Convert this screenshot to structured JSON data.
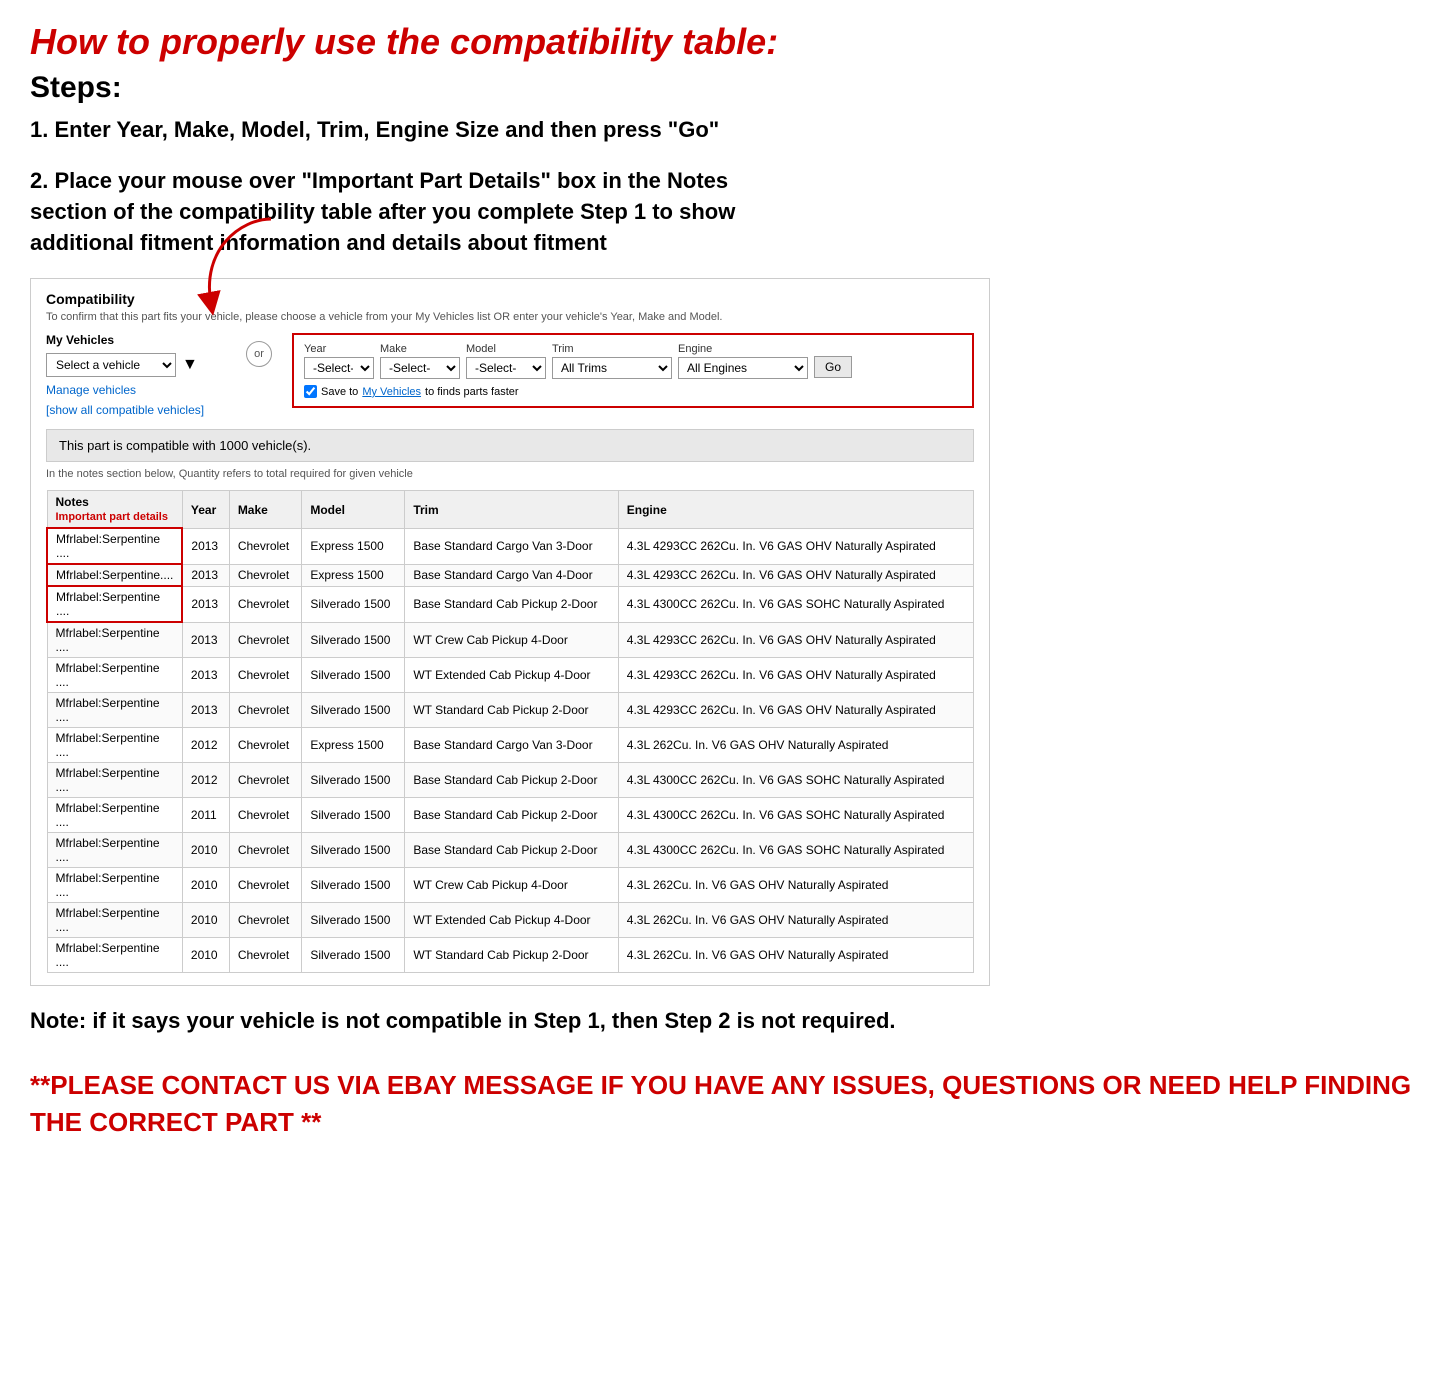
{
  "page": {
    "main_title": "How to properly use the compatibility table:",
    "steps_label": "Steps:",
    "step1": "1. Enter Year, Make, Model, Trim, Engine Size and then press \"Go\"",
    "step2_line1": "2. Place your mouse over \"Important Part Details\" box in the Notes",
    "step2_line2": "section of the compatibility table after you complete Step 1 to show",
    "step2_line3": "additional fitment information and details about fitment",
    "compat_section": {
      "title": "Compatibility",
      "subtitle": "To confirm that this part fits your vehicle, please choose a vehicle from your My Vehicles list OR enter your vehicle's Year, Make and Model.",
      "my_vehicles_label": "My Vehicles",
      "select_vehicle_placeholder": "Select a vehicle",
      "manage_vehicles": "Manage vehicles",
      "show_all": "[show all compatible vehicles]",
      "or_label": "or",
      "year_label": "Year",
      "year_value": "-Select-",
      "make_label": "Make",
      "make_value": "-Select-",
      "model_label": "Model",
      "model_value": "-Select-",
      "trim_label": "Trim",
      "trim_value": "All Trims",
      "engine_label": "Engine",
      "engine_value": "All Engines",
      "go_label": "Go",
      "save_checkbox_label": "Save to",
      "save_link": "My Vehicles",
      "save_suffix": "to finds parts faster",
      "compatible_count": "This part is compatible with 1000 vehicle(s).",
      "quantity_note": "In the notes section below, Quantity refers to total required for given vehicle",
      "table": {
        "headers": [
          "Notes",
          "Year",
          "Make",
          "Model",
          "Trim",
          "Engine"
        ],
        "notes_sub": "Important part details",
        "rows": [
          {
            "notes": "Mfrlabel:Serpentine ....",
            "year": "2013",
            "make": "Chevrolet",
            "model": "Express 1500",
            "trim": "Base Standard Cargo Van 3-Door",
            "engine": "4.3L 4293CC 262Cu. In. V6 GAS OHV Naturally Aspirated"
          },
          {
            "notes": "Mfrlabel:Serpentine....",
            "year": "2013",
            "make": "Chevrolet",
            "model": "Express 1500",
            "trim": "Base Standard Cargo Van 4-Door",
            "engine": "4.3L 4293CC 262Cu. In. V6 GAS OHV Naturally Aspirated"
          },
          {
            "notes": "Mfrlabel:Serpentine ....",
            "year": "2013",
            "make": "Chevrolet",
            "model": "Silverado 1500",
            "trim": "Base Standard Cab Pickup 2-Door",
            "engine": "4.3L 4300CC 262Cu. In. V6 GAS SOHC Naturally Aspirated"
          },
          {
            "notes": "Mfrlabel:Serpentine ....",
            "year": "2013",
            "make": "Chevrolet",
            "model": "Silverado 1500",
            "trim": "WT Crew Cab Pickup 4-Door",
            "engine": "4.3L 4293CC 262Cu. In. V6 GAS OHV Naturally Aspirated"
          },
          {
            "notes": "Mfrlabel:Serpentine ....",
            "year": "2013",
            "make": "Chevrolet",
            "model": "Silverado 1500",
            "trim": "WT Extended Cab Pickup 4-Door",
            "engine": "4.3L 4293CC 262Cu. In. V6 GAS OHV Naturally Aspirated"
          },
          {
            "notes": "Mfrlabel:Serpentine ....",
            "year": "2013",
            "make": "Chevrolet",
            "model": "Silverado 1500",
            "trim": "WT Standard Cab Pickup 2-Door",
            "engine": "4.3L 4293CC 262Cu. In. V6 GAS OHV Naturally Aspirated"
          },
          {
            "notes": "Mfrlabel:Serpentine ....",
            "year": "2012",
            "make": "Chevrolet",
            "model": "Express 1500",
            "trim": "Base Standard Cargo Van 3-Door",
            "engine": "4.3L 262Cu. In. V6 GAS OHV Naturally Aspirated"
          },
          {
            "notes": "Mfrlabel:Serpentine ....",
            "year": "2012",
            "make": "Chevrolet",
            "model": "Silverado 1500",
            "trim": "Base Standard Cab Pickup 2-Door",
            "engine": "4.3L 4300CC 262Cu. In. V6 GAS SOHC Naturally Aspirated"
          },
          {
            "notes": "Mfrlabel:Serpentine ....",
            "year": "2011",
            "make": "Chevrolet",
            "model": "Silverado 1500",
            "trim": "Base Standard Cab Pickup 2-Door",
            "engine": "4.3L 4300CC 262Cu. In. V6 GAS SOHC Naturally Aspirated"
          },
          {
            "notes": "Mfrlabel:Serpentine ....",
            "year": "2010",
            "make": "Chevrolet",
            "model": "Silverado 1500",
            "trim": "Base Standard Cab Pickup 2-Door",
            "engine": "4.3L 4300CC 262Cu. In. V6 GAS SOHC Naturally Aspirated"
          },
          {
            "notes": "Mfrlabel:Serpentine ....",
            "year": "2010",
            "make": "Chevrolet",
            "model": "Silverado 1500",
            "trim": "WT Crew Cab Pickup 4-Door",
            "engine": "4.3L 262Cu. In. V6 GAS OHV Naturally Aspirated"
          },
          {
            "notes": "Mfrlabel:Serpentine ....",
            "year": "2010",
            "make": "Chevrolet",
            "model": "Silverado 1500",
            "trim": "WT Extended Cab Pickup 4-Door",
            "engine": "4.3L 262Cu. In. V6 GAS OHV Naturally Aspirated"
          },
          {
            "notes": "Mfrlabel:Serpentine ....",
            "year": "2010",
            "make": "Chevrolet",
            "model": "Silverado 1500",
            "trim": "WT Standard Cab Pickup 2-Door",
            "engine": "4.3L 262Cu. In. V6 GAS OHV Naturally Aspirated"
          }
        ]
      }
    },
    "note_text": "Note: if it says your vehicle is not compatible in Step 1, then Step 2 is not required.",
    "contact_text": "**PLEASE CONTACT US VIA EBAY MESSAGE IF YOU HAVE ANY ISSUES, QUESTIONS OR NEED HELP FINDING THE CORRECT PART **"
  }
}
